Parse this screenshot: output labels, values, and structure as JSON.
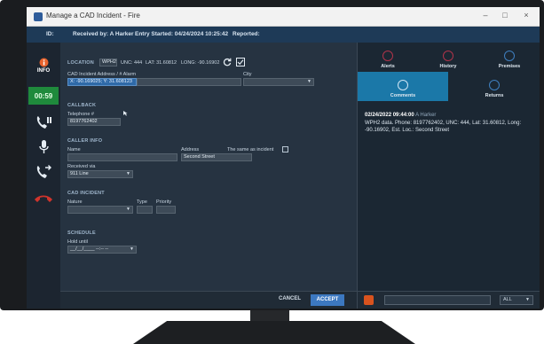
{
  "window": {
    "title": "Manage a CAD Incident - Fire",
    "controls": [
      "–",
      "□",
      "×"
    ]
  },
  "infobar": {
    "id_label": "ID:",
    "received_by": "Received by: A Harker",
    "entry_started": "Entry Started: 04/24/2024 10:25:42",
    "reported": "Reported:"
  },
  "sidebar": {
    "info_label": "INFO",
    "timer": "00:59"
  },
  "location": {
    "label": "LOCATION",
    "wph2": "WPH2",
    "unc": "UNC: 444",
    "lat": "LAT: 31.60812",
    "long": "LONG: -90.16902",
    "address_label": "CAD Incident Address / # Alarm",
    "address_value": "X: -90.169025; Y: 31.608123",
    "city_label": "City",
    "city_value": ""
  },
  "callback": {
    "section": "CALLBACK",
    "phone_label": "Telephone #",
    "phone_value": "8197762402"
  },
  "caller": {
    "section": "CALLER INFO",
    "name_label": "Name",
    "name_value": "",
    "address_label": "Address",
    "address_value": "Second Street",
    "same_label": "The same as incident",
    "received_label": "Received via",
    "received_value": "911 Line"
  },
  "incident": {
    "section": "CAD INCIDENT",
    "nature_label": "Nature",
    "type_label": "Type",
    "priority_label": "Priority"
  },
  "schedule": {
    "section": "SCHEDULE",
    "hold_label": "Hold until",
    "hold_value": "__/__/____ --:-- --"
  },
  "footer": {
    "cancel": "CANCEL",
    "accept": "ACCEPT"
  },
  "right_tabs": {
    "alerts": "Alerts",
    "history": "History",
    "premises": "Premises",
    "comments": "Comments",
    "returns": "Returns"
  },
  "comment": {
    "timestamp": "02/24/2022 09:44:00",
    "author": "A Harker",
    "text": "WPH2 data. Phone: 8197762402, UNC: 444, Lat: 31.60812, Long: -90.16902, Est. Loc.: Second Street"
  },
  "comment_box": {
    "filter": "ALL"
  },
  "colors": {
    "accent": "#3c78c0",
    "timer": "#1f8a3c",
    "hangup": "#d0342c",
    "info": "#e8632c"
  }
}
